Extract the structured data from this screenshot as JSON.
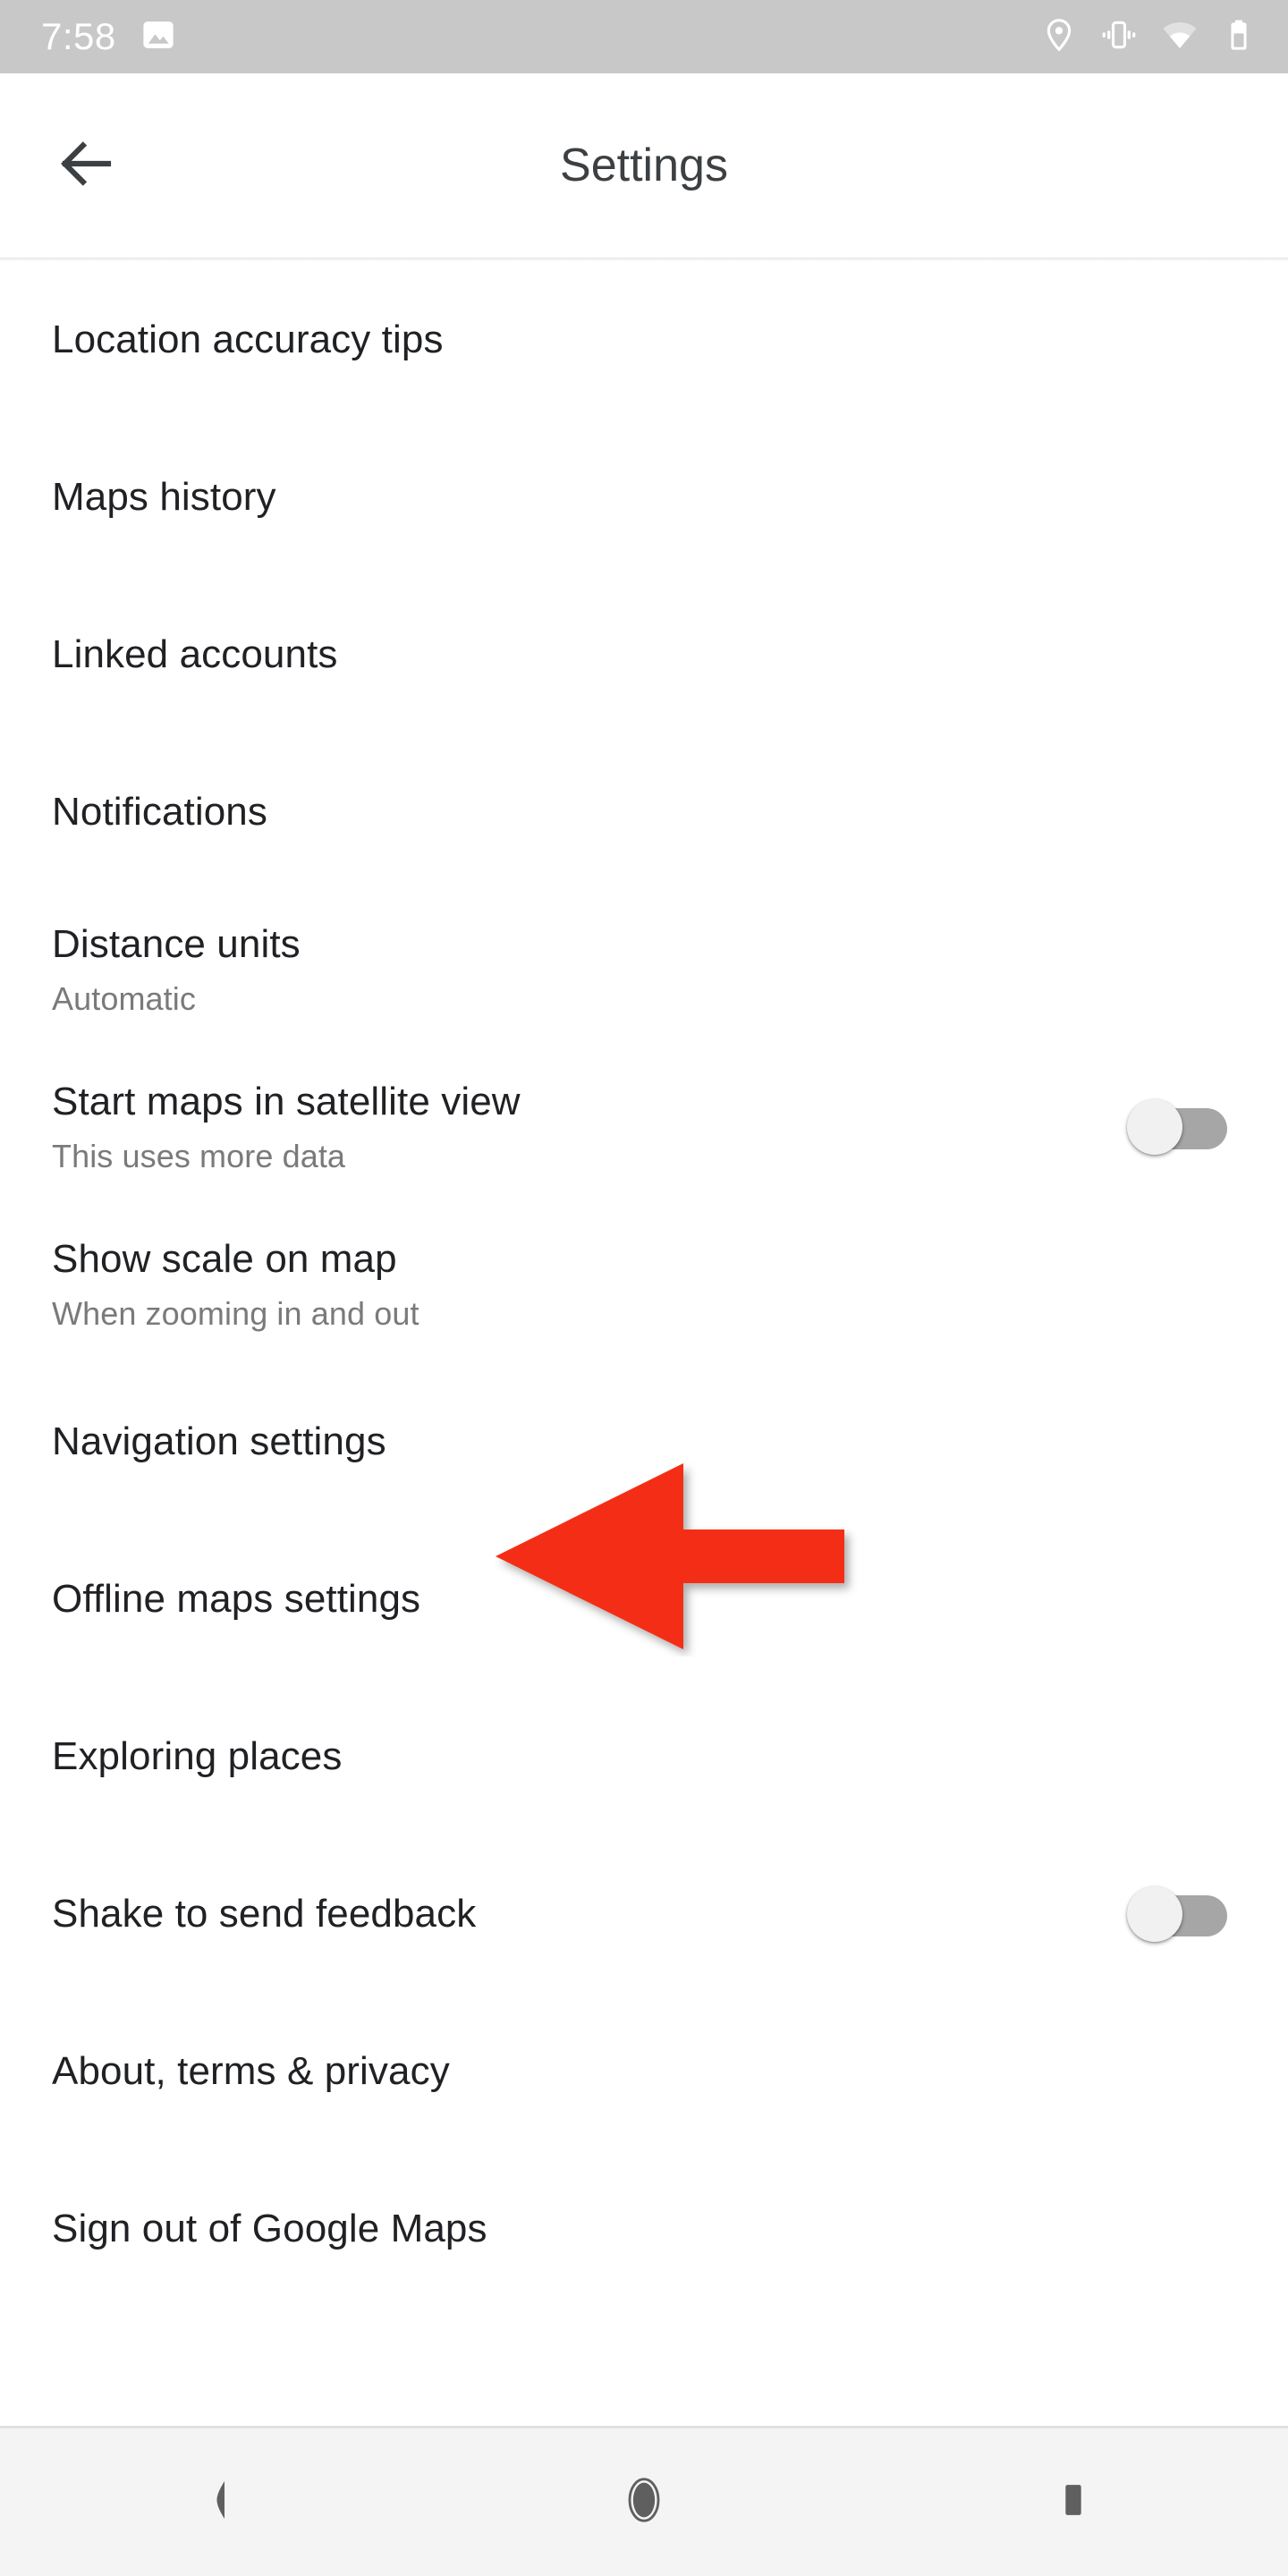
{
  "status_bar": {
    "time": "7:58",
    "left_icons": [
      {
        "name": "screenshot-image-icon"
      }
    ],
    "right_icons": [
      {
        "name": "location-pin-icon"
      },
      {
        "name": "vibrate-mode-icon"
      },
      {
        "name": "wifi-icon"
      },
      {
        "name": "battery-icon"
      }
    ],
    "background_color": "#c8c8c8",
    "icon_color": "#ffffff"
  },
  "app_bar": {
    "back_icon": "back-arrow-icon",
    "title": "Settings",
    "title_color": "#3c4043"
  },
  "settings_list": [
    {
      "id": "location-accuracy-tips",
      "title": "Location accuracy tips",
      "subtitle": null,
      "control": null
    },
    {
      "id": "maps-history",
      "title": "Maps history",
      "subtitle": null,
      "control": null
    },
    {
      "id": "linked-accounts",
      "title": "Linked accounts",
      "subtitle": null,
      "control": null
    },
    {
      "id": "notifications",
      "title": "Notifications",
      "subtitle": null,
      "control": null
    },
    {
      "id": "distance-units",
      "title": "Distance units",
      "subtitle": "Automatic",
      "control": null
    },
    {
      "id": "start-maps-in-satellite-view",
      "title": "Start maps in satellite view",
      "subtitle": "This uses more data",
      "control": "switch",
      "switch_state": "off"
    },
    {
      "id": "show-scale-on-map",
      "title": "Show scale on map",
      "subtitle": "When zooming in and out",
      "control": null
    },
    {
      "id": "navigation-settings",
      "title": "Navigation settings",
      "subtitle": null,
      "control": null
    },
    {
      "id": "offline-maps-settings",
      "title": "Offline maps settings",
      "subtitle": null,
      "control": null
    },
    {
      "id": "exploring-places",
      "title": "Exploring places",
      "subtitle": null,
      "control": null
    },
    {
      "id": "shake-to-send-feedback",
      "title": "Shake to send feedback",
      "subtitle": null,
      "control": "switch",
      "switch_state": "off"
    },
    {
      "id": "about-terms-privacy",
      "title": "About, terms & privacy",
      "subtitle": null,
      "control": null
    },
    {
      "id": "sign-out-of-google-maps",
      "title": "Sign out of Google Maps",
      "subtitle": null,
      "control": null
    }
  ],
  "annotation": {
    "type": "arrow",
    "direction": "left",
    "color": "#f42e12",
    "points_at": "navigation-settings"
  },
  "nav_bar": {
    "buttons": [
      {
        "name": "android-back-button",
        "icon": "back-triangle-icon"
      },
      {
        "name": "android-home-button",
        "icon": "home-circle-icon"
      },
      {
        "name": "android-recents-button",
        "icon": "recents-square-icon"
      }
    ],
    "background_color": "#f4f4f4",
    "icon_color": "#5f5f5f"
  },
  "theme": {
    "page_background": "#ffffff",
    "primary_text": "#202124",
    "secondary_text": "#7a7a7a",
    "switch_track_off": "#a6a6a6",
    "switch_thumb_off": "#f1f1f1"
  }
}
